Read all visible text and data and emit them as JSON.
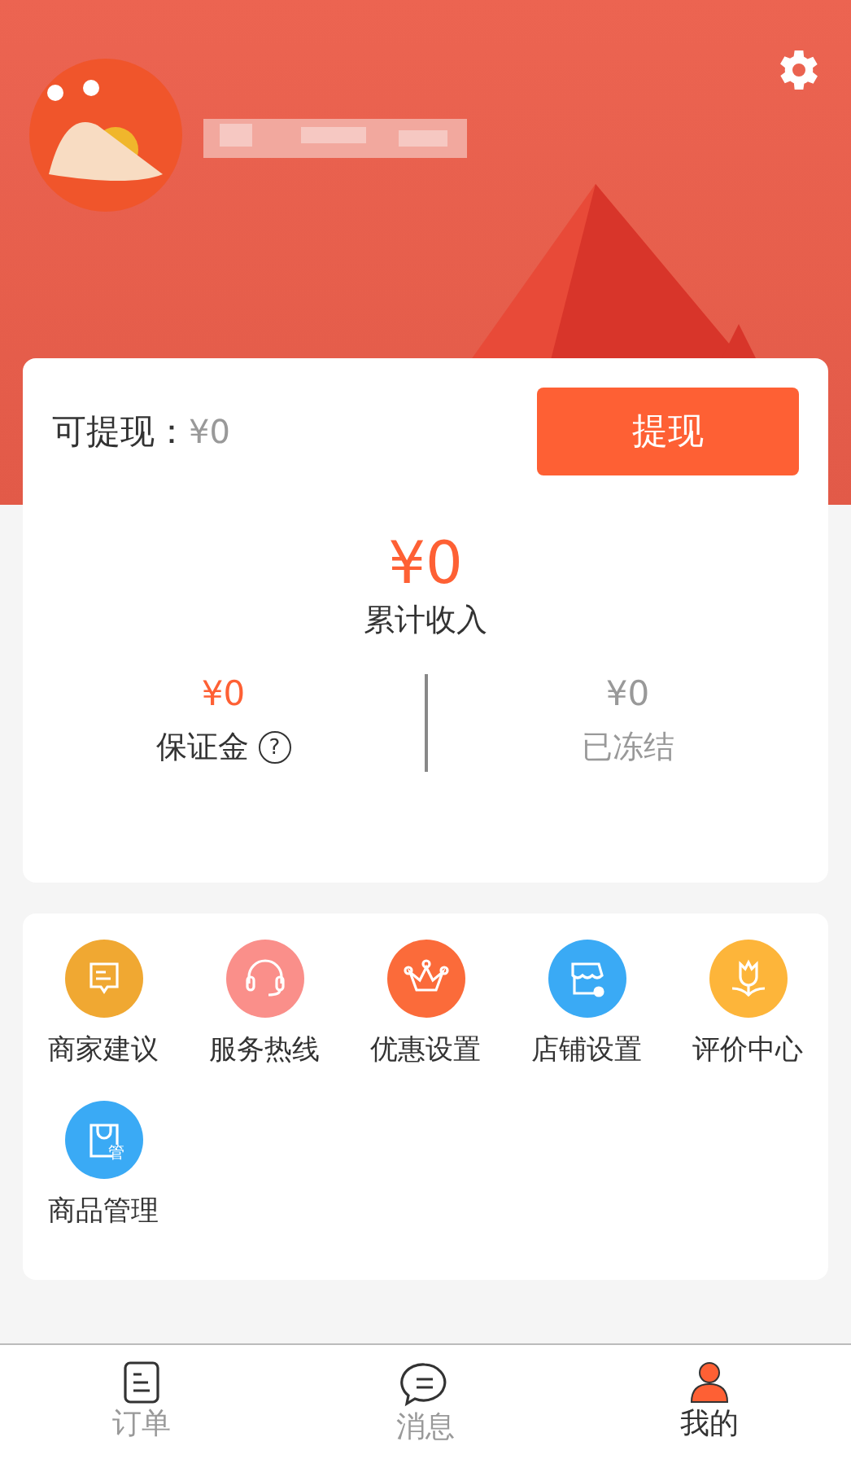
{
  "header": {
    "settings": true
  },
  "balance": {
    "label": "可提现：",
    "value": "¥0",
    "button": "提现"
  },
  "income": {
    "value": "¥0",
    "label": "累计收入"
  },
  "stats": [
    {
      "value": "¥0",
      "label": "保证金",
      "help": "?",
      "active": true
    },
    {
      "value": "¥0",
      "label": "已冻结",
      "active": false
    }
  ],
  "menu": [
    {
      "label": "商家建议",
      "kind": "chat",
      "color": "#f0a832"
    },
    {
      "label": "服务热线",
      "kind": "headset",
      "color": "#fa8f8a"
    },
    {
      "label": "优惠设置",
      "kind": "crown",
      "color": "#fb6b3a"
    },
    {
      "label": "店铺设置",
      "kind": "store",
      "color": "#3aaaf5"
    },
    {
      "label": "评价中心",
      "kind": "tulip",
      "color": "#fdb53a"
    },
    {
      "label": "商品管理",
      "kind": "bag",
      "color": "#3aaaf5",
      "badge": "管"
    }
  ],
  "tabs": [
    {
      "label": "订单",
      "kind": "doc",
      "selected": false
    },
    {
      "label": "消息",
      "kind": "chat",
      "selected": false
    },
    {
      "label": "我的",
      "kind": "user",
      "selected": true
    }
  ]
}
